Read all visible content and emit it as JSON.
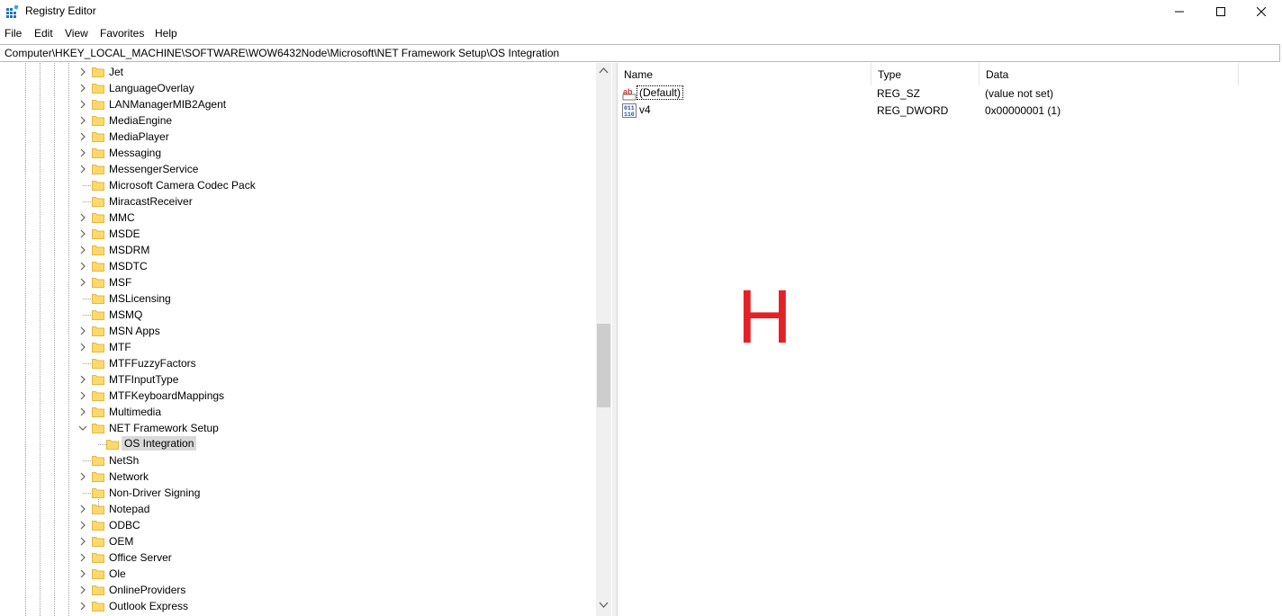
{
  "window": {
    "title": "Registry Editor"
  },
  "window_controls": {
    "minimize": "—",
    "maximize": "☐",
    "close": "✕"
  },
  "menu": {
    "items": [
      "File",
      "Edit",
      "View",
      "Favorites",
      "Help"
    ]
  },
  "address": {
    "path": "Computer\\HKEY_LOCAL_MACHINE\\SOFTWARE\\WOW6432Node\\Microsoft\\NET Framework Setup\\OS Integration"
  },
  "tree": {
    "items": [
      {
        "label": "Jet",
        "expander": "collapsed"
      },
      {
        "label": "LanguageOverlay",
        "expander": "collapsed"
      },
      {
        "label": "LANManagerMIB2Agent",
        "expander": "collapsed"
      },
      {
        "label": "MediaEngine",
        "expander": "collapsed"
      },
      {
        "label": "MediaPlayer",
        "expander": "collapsed"
      },
      {
        "label": "Messaging",
        "expander": "collapsed"
      },
      {
        "label": "MessengerService",
        "expander": "collapsed"
      },
      {
        "label": "Microsoft Camera Codec Pack",
        "expander": "none"
      },
      {
        "label": "MiracastReceiver",
        "expander": "none"
      },
      {
        "label": "MMC",
        "expander": "collapsed"
      },
      {
        "label": "MSDE",
        "expander": "collapsed"
      },
      {
        "label": "MSDRM",
        "expander": "collapsed"
      },
      {
        "label": "MSDTC",
        "expander": "collapsed"
      },
      {
        "label": "MSF",
        "expander": "collapsed"
      },
      {
        "label": "MSLicensing",
        "expander": "none"
      },
      {
        "label": "MSMQ",
        "expander": "none"
      },
      {
        "label": "MSN Apps",
        "expander": "collapsed"
      },
      {
        "label": "MTF",
        "expander": "collapsed"
      },
      {
        "label": "MTFFuzzyFactors",
        "expander": "none"
      },
      {
        "label": "MTFInputType",
        "expander": "collapsed"
      },
      {
        "label": "MTFKeyboardMappings",
        "expander": "collapsed"
      },
      {
        "label": "Multimedia",
        "expander": "collapsed"
      },
      {
        "label": "NET Framework Setup",
        "expander": "expanded"
      },
      {
        "label": "OS Integration",
        "expander": "child",
        "selected": true
      },
      {
        "label": "NetSh",
        "expander": "none"
      },
      {
        "label": "Network",
        "expander": "collapsed"
      },
      {
        "label": "Non-Driver Signing",
        "expander": "none"
      },
      {
        "label": "Notepad",
        "expander": "collapsed"
      },
      {
        "label": "ODBC",
        "expander": "collapsed"
      },
      {
        "label": "OEM",
        "expander": "collapsed"
      },
      {
        "label": "Office Server",
        "expander": "collapsed"
      },
      {
        "label": "Ole",
        "expander": "collapsed"
      },
      {
        "label": "OnlineProviders",
        "expander": "collapsed"
      },
      {
        "label": "Outlook Express",
        "expander": "collapsed"
      }
    ]
  },
  "values_list": {
    "headers": {
      "name": "Name",
      "type": "Type",
      "data": "Data"
    },
    "rows": [
      {
        "icon": "string-value-icon",
        "icon_text": "ab",
        "name": "(Default)",
        "type": "REG_SZ",
        "data": "(value not set)"
      },
      {
        "icon": "binary-value-icon",
        "icon_text": "011",
        "name": "v4",
        "type": "REG_DWORD",
        "data": "0x00000001 (1)"
      }
    ]
  },
  "overlay": {
    "letter": "H"
  },
  "colors": {
    "folder": "#ffd96b",
    "folder_edge": "#e2b843",
    "selection": "#d9d9d9",
    "overlay_letter": "#e32227",
    "string_icon": "#c0392b",
    "binary_icon": "#1f4e9c"
  }
}
